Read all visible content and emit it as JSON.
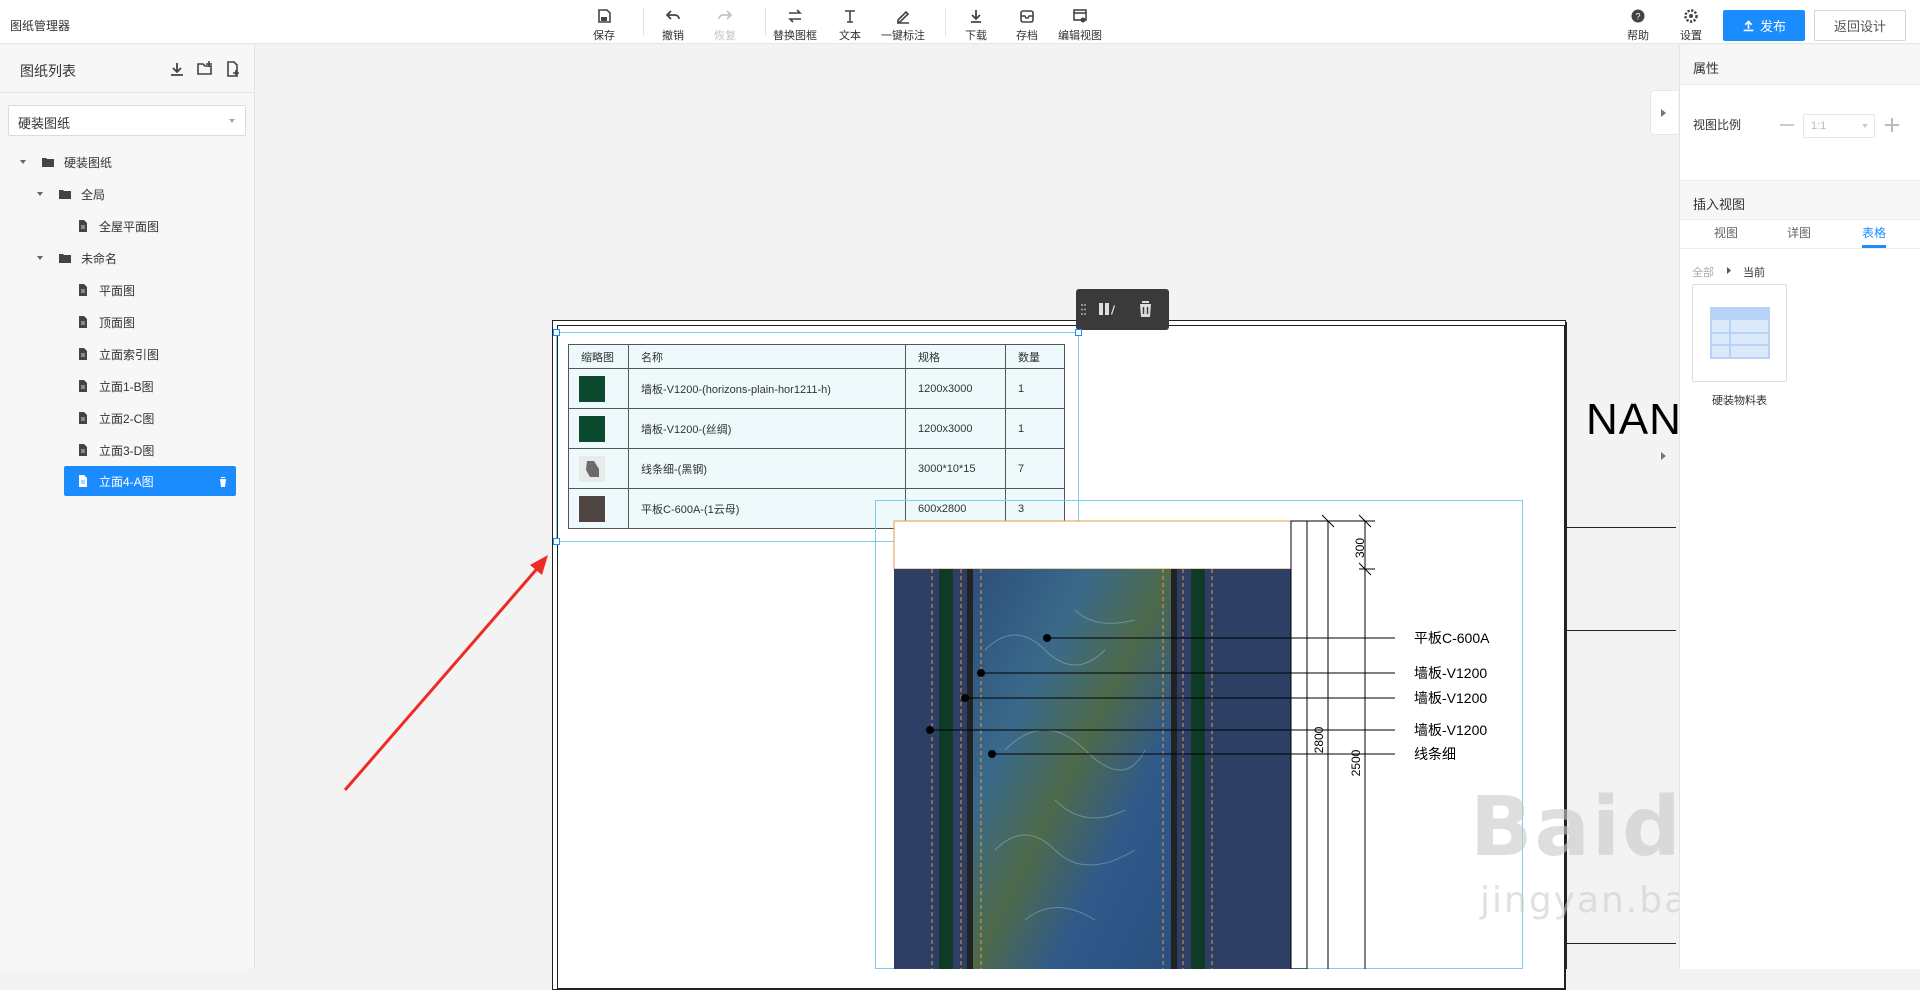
{
  "app": {
    "title": "图纸管理器"
  },
  "toolbar": {
    "save": "保存",
    "undo": "撤销",
    "redo": "恢复",
    "replace_frame": "替换图框",
    "text": "文本",
    "auto_annotate": "一键标注",
    "download": "下载",
    "archive": "存档",
    "edit_view": "编辑视图",
    "help": "帮助",
    "settings": "设置",
    "publish": "发布",
    "back": "返回设计"
  },
  "sidebar": {
    "title": "图纸列表",
    "select_value": "硬装图纸",
    "tree": [
      {
        "label": "硬装图纸"
      },
      {
        "label": "全局"
      },
      {
        "label": "全屋平面图"
      },
      {
        "label": "未命名"
      },
      {
        "label": "平面图"
      },
      {
        "label": "顶面图"
      },
      {
        "label": "立面索引图"
      },
      {
        "label": "立面1-B图"
      },
      {
        "label": "立面2-C图"
      },
      {
        "label": "立面3-D图"
      },
      {
        "label": "立面4-A图"
      }
    ]
  },
  "material_table": {
    "headers": [
      "缩略图",
      "名称",
      "规格",
      "数量"
    ],
    "rows": [
      {
        "name": "墙板-V1200-(horizons-plain-hor1211-h)",
        "spec": "1200x3000",
        "qty": "1",
        "color": "#0b4a2f"
      },
      {
        "name": "墙板-V1200-(丝绸)",
        "spec": "1200x3000",
        "qty": "1",
        "color": "#0b4a2f"
      },
      {
        "name": "线条细-(黑钢)",
        "spec": "3000*10*15",
        "qty": "7",
        "color": "#6b6b6b"
      },
      {
        "name": "平板C-600A-(1云母)",
        "spec": "600x2800",
        "qty": "3",
        "color": "#4f4540"
      }
    ]
  },
  "drawing": {
    "title_text": "NAN",
    "callouts": [
      "平板C-600A",
      "墙板-V1200",
      "墙板-V1200",
      "墙板-V1200",
      "线条细"
    ],
    "dims": [
      "300",
      "2800",
      "2500"
    ]
  },
  "right_panel": {
    "properties_title": "属性",
    "scale_label": "视图比例",
    "scale_value": "1:1",
    "insert_title": "插入视图",
    "tabs": [
      "视图",
      "详图",
      "表格"
    ],
    "active_tab": "表格",
    "breadcrumb_all": "全部",
    "breadcrumb_current": "当前",
    "thumb_label": "硬装物料表"
  },
  "watermark": {
    "brand": "Baidu经验",
    "url": "jingyan.baidu.com"
  }
}
